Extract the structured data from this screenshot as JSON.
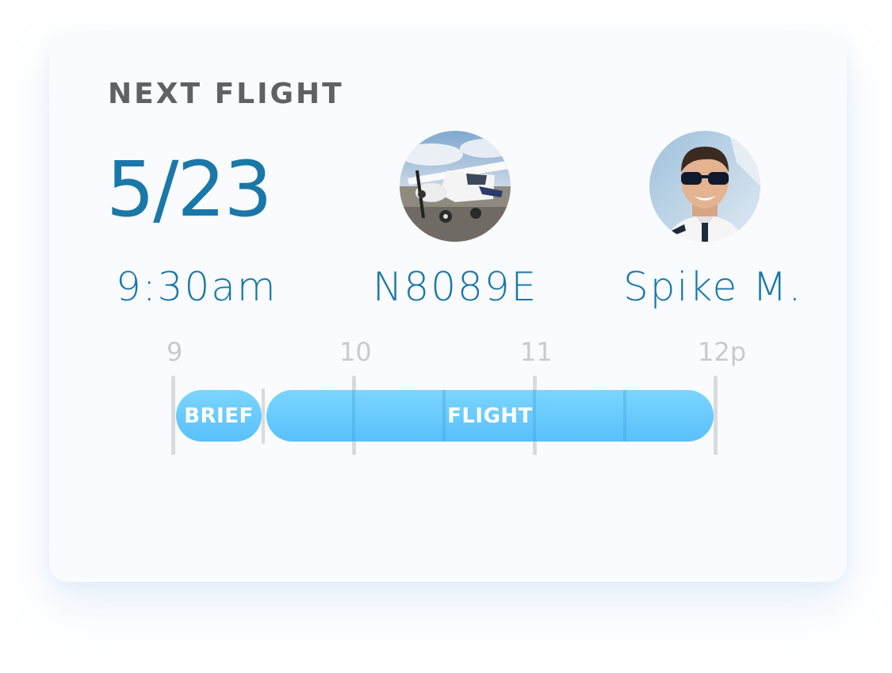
{
  "card": {
    "heading": "NEXT FLIGHT",
    "date": "5/23",
    "time": "9:30am",
    "aircraft": {
      "tail_number": "N8089E",
      "photo_icon": "airplane-photo"
    },
    "instructor": {
      "name": "Spike M.",
      "photo_icon": "pilot-avatar"
    }
  },
  "timeline": {
    "ticks": [
      "9",
      "10",
      "11",
      "12p"
    ],
    "blocks": [
      {
        "label": "BRIEF",
        "type": "brief"
      },
      {
        "label": "FLIGHT",
        "type": "flight"
      }
    ]
  },
  "colors": {
    "accent_text": "#1a78a8",
    "heading": "#5f6165",
    "block_fill": "#5fc4fb",
    "tick": "#d8dadc"
  }
}
